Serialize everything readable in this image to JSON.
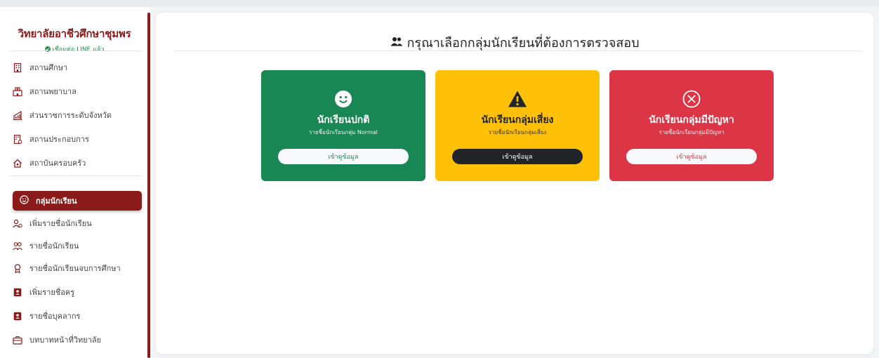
{
  "sidebar": {
    "brand_title": "วิทยาลัยอาชีวศึกษาชุมพร",
    "brand_status": "เชื่อมต่อ LINE แล้ว",
    "items": [
      {
        "label": "สถานศึกษา",
        "icon": "building-icon"
      },
      {
        "label": "สถานพยาบาล",
        "icon": "hospital-icon"
      },
      {
        "label": "ส่วนราชการระดับจังหวัด",
        "icon": "government-building-icon"
      },
      {
        "label": "สถานประกอบการ",
        "icon": "office-icon"
      },
      {
        "label": "สถาบันครอบครัว",
        "icon": "home-icon"
      }
    ],
    "active_item": {
      "label": "กลุ่มนักเรียน",
      "icon": "smile-icon"
    },
    "items_lower": [
      {
        "label": "เพิ่มรายชื่อนักเรียน",
        "icon": "user-add-icon"
      },
      {
        "label": "รายชื่อนักเรียน",
        "icon": "users-icon"
      },
      {
        "label": "รายชื่อนักเรียนจบการศึกษา",
        "icon": "award-icon"
      },
      {
        "label": "เพิ่มรายชื่อครู",
        "icon": "id-card-icon"
      },
      {
        "label": "รายชื่อบุคลากร",
        "icon": "id-badge-icon"
      },
      {
        "label": "บทบาทหน้าที่วิทยาลัย",
        "icon": "briefcase-icon"
      }
    ]
  },
  "main": {
    "heading": "กรุณาเลือกกลุ่มนักเรียนที่ต้องการตรวจสอบ",
    "heading_icon": "users-icon",
    "cards": [
      {
        "title": "นักเรียนปกติ",
        "subtitle": "รายชื่อนักเรียนกลุ่ม Normal",
        "button": "เข้าดูข้อมูล",
        "icon": "smile-icon",
        "color": "#198754"
      },
      {
        "title": "นักเรียนกลุ่มเสี่ยง",
        "subtitle": "รายชื่อนักเรียนกลุ่มเสี่ยง",
        "button": "เข้าดูข้อมูล",
        "icon": "warning-icon",
        "color": "#ffc107"
      },
      {
        "title": "นักเรียนกลุ่มมีปัญหา",
        "subtitle": "รายชื่อนักเรียนกลุ่มมีปัญหา",
        "button": "เข้าดูข้อมูล",
        "icon": "close-circle-icon",
        "color": "#dc3545"
      }
    ]
  },
  "colors": {
    "brand": "#8b1a1a",
    "success": "#198754",
    "warning": "#ffc107",
    "danger": "#dc3545"
  }
}
